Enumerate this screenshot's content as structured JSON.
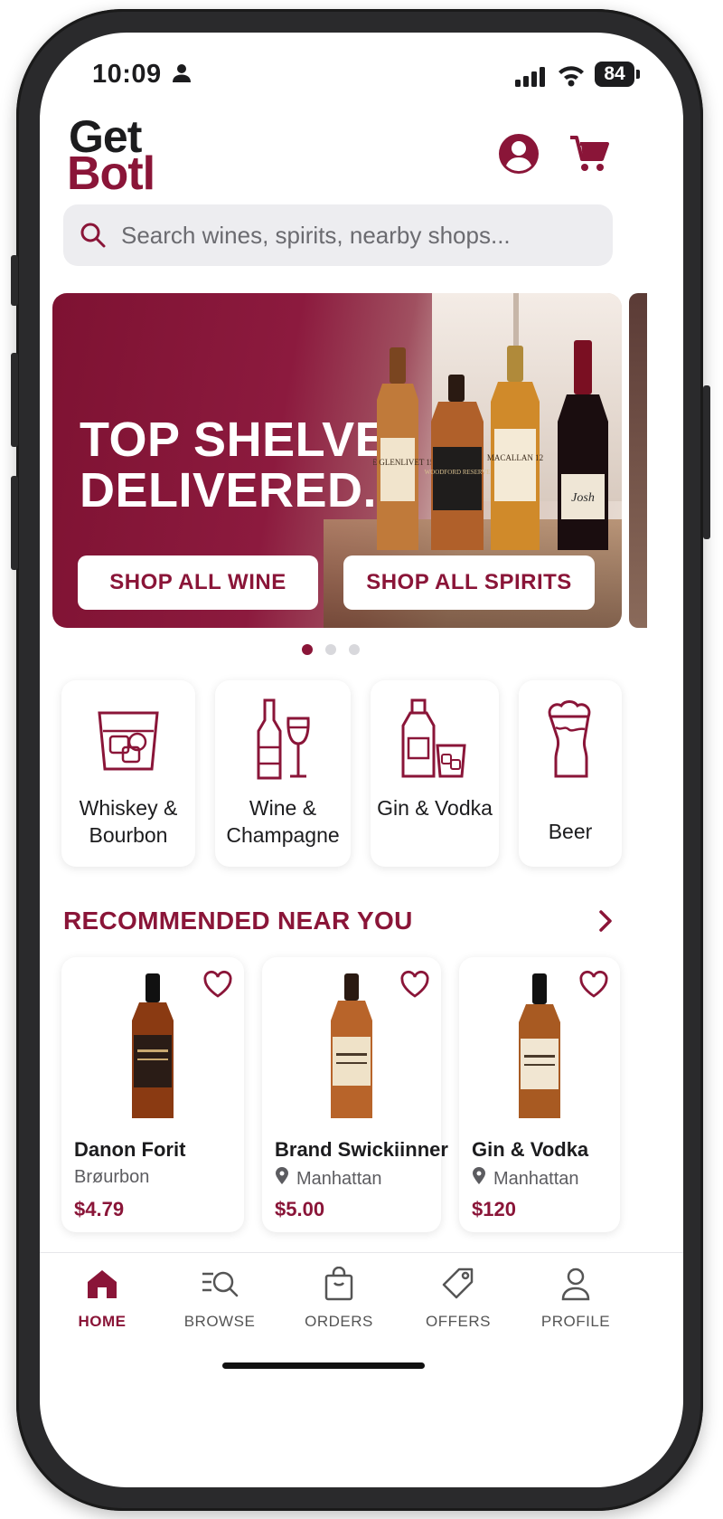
{
  "status": {
    "time": "10:09",
    "battery": "84"
  },
  "brand": {
    "logo_line1": "Get",
    "logo_line2": "Botl",
    "accent": "#8a1538"
  },
  "header": {
    "account_icon": "account-icon",
    "cart_icon": "cart-icon"
  },
  "search": {
    "placeholder": "Search wines, spirits, nearby shops..."
  },
  "hero": {
    "title_line1": "TOP SHELVES",
    "title_line2": "DELIVERED.",
    "buttons": [
      "SHOP ALL WINE",
      "SHOP ALL SPIRITS"
    ],
    "bottle_labels": [
      "THE GLENLIVET 15",
      "WOODFORD RESERVE",
      "MACALLAN 12",
      "Josh"
    ],
    "carousel": {
      "count": 3,
      "active": 0
    }
  },
  "categories": [
    {
      "label": "Whiskey & Bourbon",
      "icon": "whiskey-glass-icon"
    },
    {
      "label": "Wine & Champagne",
      "icon": "wine-bottle-icon"
    },
    {
      "label": "Gin & Vodka",
      "icon": "gin-bottle-icon"
    },
    {
      "label": "Beer",
      "icon": "beer-glass-icon"
    }
  ],
  "recommended": {
    "title": "RECOMMENDED NEAR YOU",
    "products": [
      {
        "name": "Danon Forit",
        "subtitle": "Brøurbon",
        "location_pin": false,
        "price": "$4.79"
      },
      {
        "name": "Brand Swickiinner",
        "subtitle": "Manhattan",
        "location_pin": true,
        "price": "$5.00"
      },
      {
        "name": "Gin & Vodka",
        "subtitle": "Manhattan",
        "location_pin": true,
        "price": "$120"
      }
    ]
  },
  "tabs": [
    {
      "label": "HOME",
      "icon": "home-icon",
      "active": true
    },
    {
      "label": "BROWSE",
      "icon": "browse-icon",
      "active": false
    },
    {
      "label": "ORDERS",
      "icon": "orders-bag-icon",
      "active": false
    },
    {
      "label": "OFFERS",
      "icon": "offers-tag-icon",
      "active": false
    },
    {
      "label": "PROFILE",
      "icon": "profile-icon",
      "active": false
    }
  ]
}
